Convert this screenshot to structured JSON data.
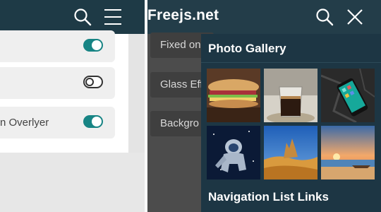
{
  "left_panel": {
    "settings": [
      {
        "label": "",
        "toggle": "on"
      },
      {
        "label": "",
        "toggle": "off"
      },
      {
        "label": "n Overlyer",
        "toggle": "on"
      }
    ],
    "icons": [
      "search-icon",
      "menu-icon"
    ]
  },
  "right_panel": {
    "brand": "Freejs.net",
    "icons": [
      "search-icon",
      "close-icon"
    ],
    "background_items": [
      "Fixed on",
      "Glass Eff",
      "Backgro"
    ]
  },
  "gallery": {
    "title": "Photo Gallery",
    "images": [
      "sandwich-image",
      "coffee-image",
      "phone-image",
      "astronaut-image",
      "desert-image",
      "beach-image"
    ],
    "nav_title": "Navigation List Links"
  },
  "colors": {
    "header": "#1e3a46",
    "accent_toggle": "#178484",
    "gallery_bg": "#1d3644"
  }
}
